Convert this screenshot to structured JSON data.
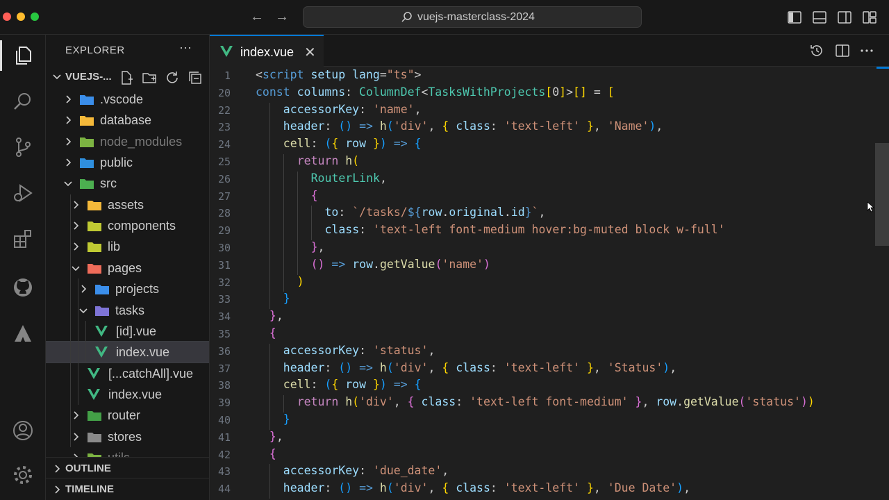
{
  "window": {
    "title": "vuejs-masterclass-2024"
  },
  "titlebar": {
    "back_icon": "arrow-left-icon",
    "forward_icon": "arrow-right-icon",
    "layout_icons": [
      "toggle-primary-sidebar-icon",
      "toggle-panel-icon",
      "toggle-secondary-sidebar-icon",
      "customize-layout-icon"
    ]
  },
  "activity_bar": {
    "items": [
      "explorer-icon",
      "search-icon",
      "source-control-icon",
      "run-debug-icon",
      "extensions-icon",
      "github-icon",
      "triangle-extension-icon"
    ],
    "bottom": [
      "accounts-icon",
      "manage-gear-icon"
    ]
  },
  "sidebar": {
    "title": "EXPLORER",
    "more": "···",
    "folder_name": "VUEJS-...",
    "tree": [
      {
        "name": ".vscode",
        "depth": 0,
        "type": "folder",
        "expanded": false,
        "color": "#3b8eea"
      },
      {
        "name": "database",
        "depth": 0,
        "type": "folder",
        "expanded": false,
        "color": "#f5b93a"
      },
      {
        "name": "node_modules",
        "depth": 0,
        "type": "folder",
        "expanded": false,
        "color": "#7cb342",
        "dim": true
      },
      {
        "name": "public",
        "depth": 0,
        "type": "folder",
        "expanded": false,
        "color": "#2f8fde"
      },
      {
        "name": "src",
        "depth": 0,
        "type": "folder",
        "expanded": true,
        "color": "#4caf50"
      },
      {
        "name": "assets",
        "depth": 1,
        "type": "folder",
        "expanded": false,
        "color": "#f5b93a"
      },
      {
        "name": "components",
        "depth": 1,
        "type": "folder",
        "expanded": false,
        "color": "#c0ca33"
      },
      {
        "name": "lib",
        "depth": 1,
        "type": "folder",
        "expanded": false,
        "color": "#c0ca33"
      },
      {
        "name": "pages",
        "depth": 1,
        "type": "folder",
        "expanded": true,
        "color": "#ef6c5a"
      },
      {
        "name": "projects",
        "depth": 2,
        "type": "folder",
        "expanded": false,
        "color": "#3b8eea"
      },
      {
        "name": "tasks",
        "depth": 2,
        "type": "folder",
        "expanded": true,
        "color": "#7e74d6"
      },
      {
        "name": "[id].vue",
        "depth": 3,
        "type": "vue"
      },
      {
        "name": "index.vue",
        "depth": 3,
        "type": "vue",
        "selected": true
      },
      {
        "name": "[...catchAll].vue",
        "depth": 2,
        "type": "vue"
      },
      {
        "name": "index.vue",
        "depth": 2,
        "type": "vue"
      },
      {
        "name": "router",
        "depth": 1,
        "type": "folder",
        "expanded": false,
        "color": "#43a047"
      },
      {
        "name": "stores",
        "depth": 1,
        "type": "folder",
        "expanded": false,
        "color": "#8a8a8a"
      },
      {
        "name": "utils",
        "depth": 1,
        "type": "folder",
        "expanded": false,
        "color": "#7cb342",
        "dim": true
      }
    ],
    "outline_label": "OUTLINE",
    "timeline_label": "TIMELINE"
  },
  "editor": {
    "tab_label": "index.vue",
    "tab_icons": [
      "timeline-history-icon",
      "split-editor-icon",
      "more-actions-icon"
    ],
    "lines": [
      {
        "n": "1",
        "indent": 0,
        "tokens": [
          [
            "pu",
            "<"
          ],
          [
            "kb",
            "script"
          ],
          [
            "pu",
            " "
          ],
          [
            "va",
            "setup"
          ],
          [
            "pu",
            " "
          ],
          [
            "va",
            "lang"
          ],
          [
            "pu",
            "="
          ],
          [
            "st",
            "\"ts\""
          ],
          [
            "pu",
            ">"
          ]
        ]
      },
      {
        "n": "20",
        "indent": 0,
        "tokens": [
          [
            "kb",
            "const "
          ],
          [
            "va",
            "columns"
          ],
          [
            "pu",
            ": "
          ],
          [
            "ty",
            "ColumnDef"
          ],
          [
            "pu",
            "<"
          ],
          [
            "ty",
            "TasksWithProjects"
          ],
          [
            "br1",
            "["
          ],
          [
            "pu",
            "0"
          ],
          [
            "br1",
            "]"
          ],
          [
            "pu",
            ">"
          ],
          [
            "br1",
            "[]"
          ],
          [
            "pu",
            " = "
          ],
          [
            "br1",
            "["
          ]
        ]
      },
      {
        "n": "22",
        "indent": 2,
        "tokens": [
          [
            "va",
            "accessorKey"
          ],
          [
            "pu",
            ": "
          ],
          [
            "st",
            "'name'"
          ],
          [
            "pu",
            ","
          ]
        ]
      },
      {
        "n": "23",
        "indent": 2,
        "tokens": [
          [
            "va",
            "header"
          ],
          [
            "pu",
            ": "
          ],
          [
            "br3",
            "()"
          ],
          [
            "pu",
            " "
          ],
          [
            "kb",
            "=>"
          ],
          [
            "pu",
            " "
          ],
          [
            "fn",
            "h"
          ],
          [
            "br3",
            "("
          ],
          [
            "st",
            "'div'"
          ],
          [
            "pu",
            ", "
          ],
          [
            "br1",
            "{ "
          ],
          [
            "va",
            "class"
          ],
          [
            "pu",
            ": "
          ],
          [
            "st",
            "'text-left'"
          ],
          [
            "br1",
            " }"
          ],
          [
            "pu",
            ", "
          ],
          [
            "st",
            "'Name'"
          ],
          [
            "br3",
            ")"
          ],
          [
            "pu",
            ","
          ]
        ]
      },
      {
        "n": "24",
        "indent": 2,
        "tokens": [
          [
            "fn",
            "cell"
          ],
          [
            "pu",
            ": "
          ],
          [
            "br3",
            "("
          ],
          [
            "br1",
            "{ "
          ],
          [
            "va",
            "row"
          ],
          [
            "br1",
            " }"
          ],
          [
            "br3",
            ")"
          ],
          [
            "pu",
            " "
          ],
          [
            "kb",
            "=>"
          ],
          [
            "pu",
            " "
          ],
          [
            "br3",
            "{"
          ]
        ]
      },
      {
        "n": "25",
        "indent": 3,
        "tokens": [
          [
            "kw",
            "return "
          ],
          [
            "fn",
            "h"
          ],
          [
            "br1",
            "("
          ]
        ]
      },
      {
        "n": "26",
        "indent": 4,
        "tokens": [
          [
            "ty",
            "RouterLink"
          ],
          [
            "pu",
            ","
          ]
        ]
      },
      {
        "n": "27",
        "indent": 4,
        "tokens": [
          [
            "br2",
            "{"
          ]
        ]
      },
      {
        "n": "28",
        "indent": 5,
        "tokens": [
          [
            "va",
            "to"
          ],
          [
            "pu",
            ": "
          ],
          [
            "st",
            "`/tasks/"
          ],
          [
            "kb",
            "${"
          ],
          [
            "va",
            "row"
          ],
          [
            "pu",
            "."
          ],
          [
            "va",
            "original"
          ],
          [
            "pu",
            "."
          ],
          [
            "va",
            "id"
          ],
          [
            "kb",
            "}"
          ],
          [
            "st",
            "`"
          ],
          [
            "pu",
            ","
          ]
        ]
      },
      {
        "n": "29",
        "indent": 5,
        "tokens": [
          [
            "va",
            "class"
          ],
          [
            "pu",
            ": "
          ],
          [
            "st",
            "'text-left font-medium hover:bg-muted block w-full'"
          ]
        ]
      },
      {
        "n": "30",
        "indent": 4,
        "tokens": [
          [
            "br2",
            "}"
          ],
          [
            "pu",
            ","
          ]
        ]
      },
      {
        "n": "31",
        "indent": 4,
        "tokens": [
          [
            "br2",
            "()"
          ],
          [
            "pu",
            " "
          ],
          [
            "kb",
            "=>"
          ],
          [
            "pu",
            " "
          ],
          [
            "va",
            "row"
          ],
          [
            "pu",
            "."
          ],
          [
            "fn",
            "getValue"
          ],
          [
            "br2",
            "("
          ],
          [
            "st",
            "'name'"
          ],
          [
            "br2",
            ")"
          ]
        ]
      },
      {
        "n": "32",
        "indent": 3,
        "tokens": [
          [
            "br1",
            ")"
          ]
        ]
      },
      {
        "n": "33",
        "indent": 2,
        "tokens": [
          [
            "br3",
            "}"
          ]
        ]
      },
      {
        "n": "34",
        "indent": 1,
        "tokens": [
          [
            "br2",
            "}"
          ],
          [
            "pu",
            ","
          ]
        ]
      },
      {
        "n": "35",
        "indent": 1,
        "tokens": [
          [
            "br2",
            "{"
          ]
        ]
      },
      {
        "n": "36",
        "indent": 2,
        "tokens": [
          [
            "va",
            "accessorKey"
          ],
          [
            "pu",
            ": "
          ],
          [
            "st",
            "'status'"
          ],
          [
            "pu",
            ","
          ]
        ]
      },
      {
        "n": "37",
        "indent": 2,
        "tokens": [
          [
            "va",
            "header"
          ],
          [
            "pu",
            ": "
          ],
          [
            "br3",
            "()"
          ],
          [
            "pu",
            " "
          ],
          [
            "kb",
            "=>"
          ],
          [
            "pu",
            " "
          ],
          [
            "fn",
            "h"
          ],
          [
            "br3",
            "("
          ],
          [
            "st",
            "'div'"
          ],
          [
            "pu",
            ", "
          ],
          [
            "br1",
            "{ "
          ],
          [
            "va",
            "class"
          ],
          [
            "pu",
            ": "
          ],
          [
            "st",
            "'text-left'"
          ],
          [
            "br1",
            " }"
          ],
          [
            "pu",
            ", "
          ],
          [
            "st",
            "'Status'"
          ],
          [
            "br3",
            ")"
          ],
          [
            "pu",
            ","
          ]
        ]
      },
      {
        "n": "38",
        "indent": 2,
        "tokens": [
          [
            "fn",
            "cell"
          ],
          [
            "pu",
            ": "
          ],
          [
            "br3",
            "("
          ],
          [
            "br1",
            "{ "
          ],
          [
            "va",
            "row"
          ],
          [
            "br1",
            " }"
          ],
          [
            "br3",
            ")"
          ],
          [
            "pu",
            " "
          ],
          [
            "kb",
            "=>"
          ],
          [
            "pu",
            " "
          ],
          [
            "br3",
            "{"
          ]
        ]
      },
      {
        "n": "39",
        "indent": 3,
        "tokens": [
          [
            "kw",
            "return "
          ],
          [
            "fn",
            "h"
          ],
          [
            "br1",
            "("
          ],
          [
            "st",
            "'div'"
          ],
          [
            "pu",
            ", "
          ],
          [
            "br2",
            "{ "
          ],
          [
            "va",
            "class"
          ],
          [
            "pu",
            ": "
          ],
          [
            "st",
            "'text-left font-medium'"
          ],
          [
            "br2",
            " }"
          ],
          [
            "pu",
            ", "
          ],
          [
            "va",
            "row"
          ],
          [
            "pu",
            "."
          ],
          [
            "fn",
            "getValue"
          ],
          [
            "br2",
            "("
          ],
          [
            "st",
            "'status'"
          ],
          [
            "br2",
            ")"
          ],
          [
            "br1",
            ")"
          ]
        ]
      },
      {
        "n": "40",
        "indent": 2,
        "tokens": [
          [
            "br3",
            "}"
          ]
        ]
      },
      {
        "n": "41",
        "indent": 1,
        "tokens": [
          [
            "br2",
            "}"
          ],
          [
            "pu",
            ","
          ]
        ]
      },
      {
        "n": "42",
        "indent": 1,
        "tokens": [
          [
            "br2",
            "{"
          ]
        ]
      },
      {
        "n": "43",
        "indent": 2,
        "tokens": [
          [
            "va",
            "accessorKey"
          ],
          [
            "pu",
            ": "
          ],
          [
            "st",
            "'due_date'"
          ],
          [
            "pu",
            ","
          ]
        ]
      },
      {
        "n": "44",
        "indent": 2,
        "tokens": [
          [
            "va",
            "header"
          ],
          [
            "pu",
            ": "
          ],
          [
            "br3",
            "()"
          ],
          [
            "pu",
            " "
          ],
          [
            "kb",
            "=>"
          ],
          [
            "pu",
            " "
          ],
          [
            "fn",
            "h"
          ],
          [
            "br3",
            "("
          ],
          [
            "st",
            "'div'"
          ],
          [
            "pu",
            ", "
          ],
          [
            "br1",
            "{ "
          ],
          [
            "va",
            "class"
          ],
          [
            "pu",
            ": "
          ],
          [
            "st",
            "'text-left'"
          ],
          [
            "br1",
            " }"
          ],
          [
            "pu",
            ", "
          ],
          [
            "st",
            "'Due Date'"
          ],
          [
            "br3",
            ")"
          ],
          [
            "pu",
            ","
          ]
        ]
      }
    ]
  },
  "colors": {
    "accent": "#0078d4",
    "background": "#1f1f1f",
    "sidebar": "#181818",
    "vue_green": "#41b883"
  }
}
